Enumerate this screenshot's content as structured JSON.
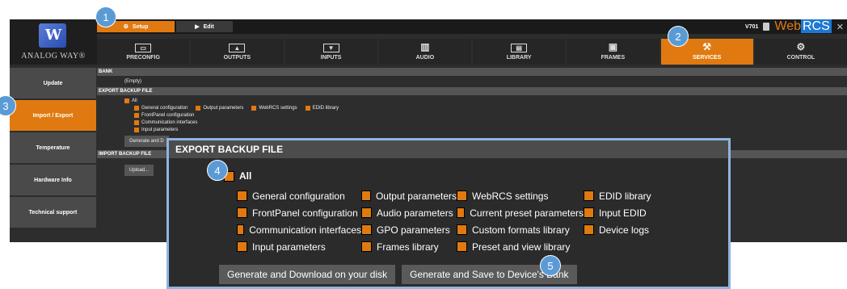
{
  "brand": {
    "logo_glyph": "W",
    "name": "ANALOG WAY®"
  },
  "topbar": {
    "modes": [
      {
        "label": "Setup",
        "icon": "gear-icon"
      },
      {
        "label": "Edit",
        "icon": "play-icon"
      }
    ],
    "device": "V701",
    "app_name_a": "Web",
    "app_name_b": "RCS",
    "close_glyph": "✕"
  },
  "nav": {
    "items": [
      {
        "label": "PRECONFIG",
        "glyph": "▭"
      },
      {
        "label": "OUTPUTS",
        "glyph": "▲"
      },
      {
        "label": "INPUTS",
        "glyph": "▼"
      },
      {
        "label": "AUDIO",
        "glyph": "▥"
      },
      {
        "label": "LIBRARY",
        "glyph": "▤"
      },
      {
        "label": "FRAMES",
        "glyph": "▣"
      },
      {
        "label": "SERVICES",
        "glyph": "⚒"
      },
      {
        "label": "CONTROL",
        "glyph": "⚙"
      }
    ],
    "active": "SERVICES"
  },
  "sidebar": {
    "items": [
      {
        "label": "Update"
      },
      {
        "label": "Import / Export"
      },
      {
        "label": "Temperature"
      },
      {
        "label": "Hardware Info"
      },
      {
        "label": "Technical support"
      }
    ],
    "active": "Import / Export"
  },
  "main": {
    "bank_title": "BANK",
    "bank_value": "(Empty)",
    "export_title": "EXPORT BACKUP FILE",
    "export_all": "All",
    "export_row1": [
      "General configuration",
      "Output parameters",
      "WebRCS settings",
      "EDID library"
    ],
    "export_row2": [
      "FrontPanel configuration"
    ],
    "export_row3": [
      "Communication interfaces"
    ],
    "export_row4": [
      "Input parameters"
    ],
    "generate_button": "Generate and D",
    "import_title": "IMPORT BACKUP FILE",
    "upload_button": "Upload..."
  },
  "zoom": {
    "title": "EXPORT BACKUP FILE",
    "all_label": "All",
    "rows": [
      [
        "General configuration",
        "Output parameters",
        "WebRCS settings",
        "EDID library"
      ],
      [
        "FrontPanel configuration",
        "Audio parameters",
        "Current preset parameters",
        "Input EDID"
      ],
      [
        "Communication interfaces",
        "GPO parameters",
        "Custom formats library",
        "Device logs"
      ],
      [
        "Input parameters",
        "Frames library",
        "Preset and view library",
        ""
      ]
    ],
    "btn_download": "Generate and Download on your disk",
    "btn_save": "Generate and Save to Device's Bank"
  },
  "badges": [
    "1",
    "2",
    "3",
    "4",
    "5"
  ],
  "colors": {
    "accent": "#e07a10",
    "badge": "#5b9bd5",
    "panel": "#2d2d2d",
    "header": "#555555"
  }
}
